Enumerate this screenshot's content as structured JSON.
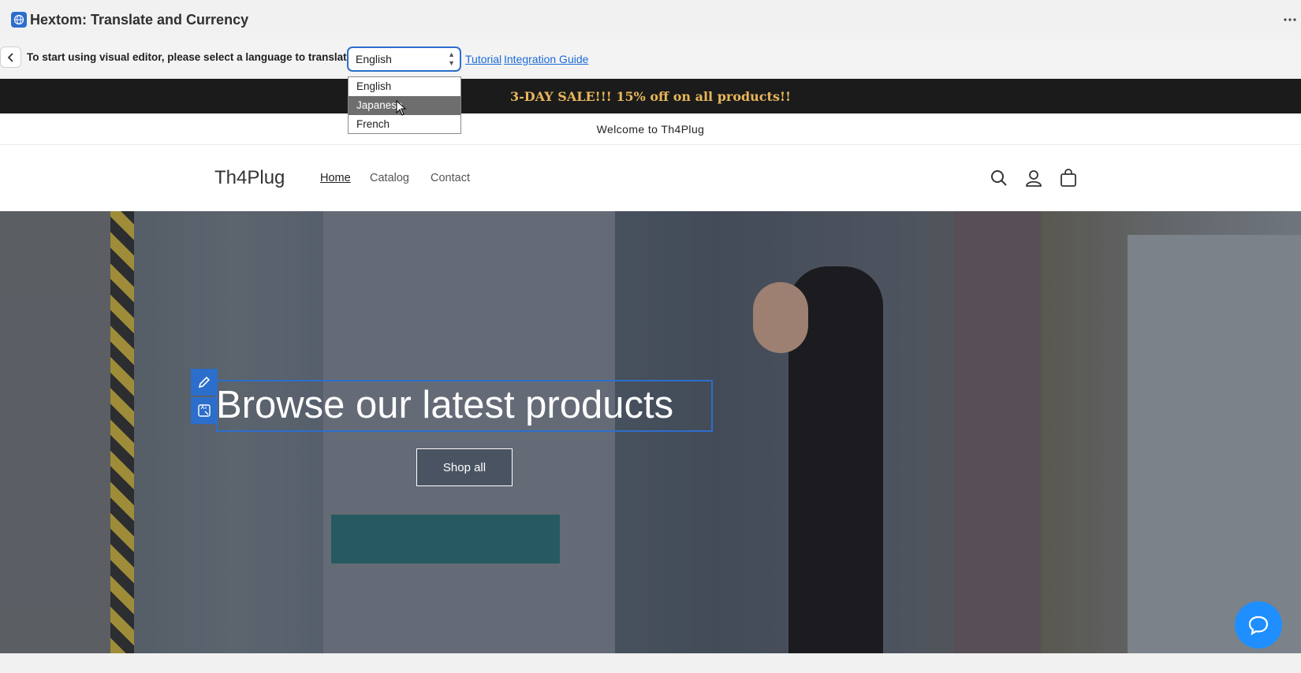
{
  "app": {
    "title": "Hextom: Translate and Currency",
    "icon": "globe-icon",
    "more_icon": "more-dots-icon"
  },
  "toolbar": {
    "back_icon": "chevron-left-icon",
    "instruction": "To start using visual editor, please select a language to translate:",
    "language_select": {
      "value": "English",
      "options": [
        "English",
        "Japanese",
        "French"
      ],
      "highlighted": "Japanese"
    },
    "tutorial_link": "Tutorial",
    "integration_link": "Integration Guide"
  },
  "store": {
    "announcement": "3-DAY SALE!!! 15% off on all products!!",
    "welcome": "Welcome to Th4Plug",
    "logo": "Th4Plug",
    "nav": [
      "Home",
      "Catalog",
      "Contact"
    ],
    "icons": [
      "search-icon",
      "account-icon",
      "cart-icon"
    ],
    "hero": {
      "title": "Browse our latest products",
      "button": "Shop all"
    }
  },
  "colors": {
    "accent": "#2c6ecb",
    "announcement_text": "#e8b75b",
    "chat": "#1f8fff"
  }
}
